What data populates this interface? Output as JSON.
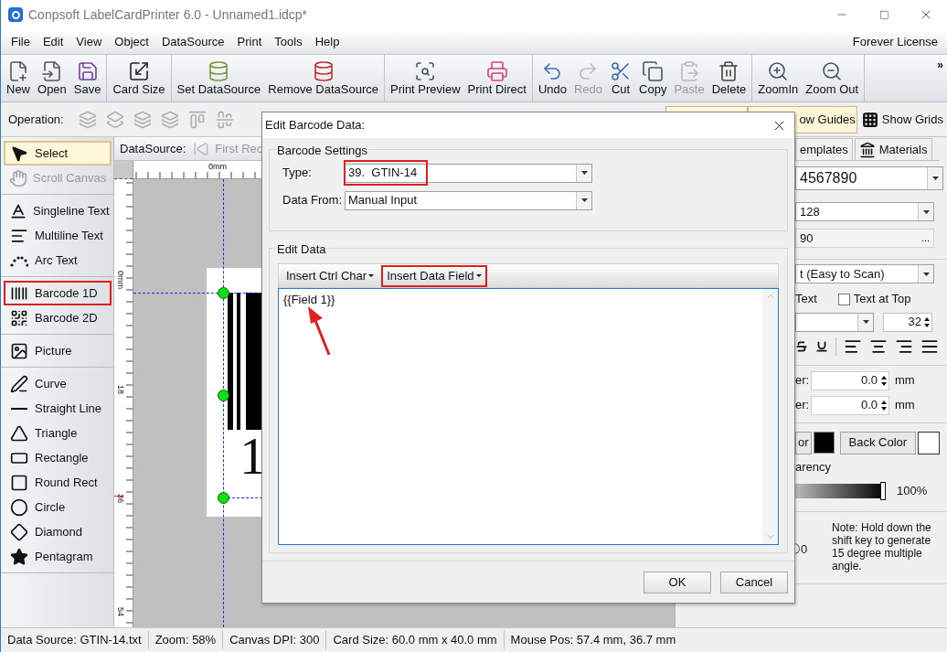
{
  "window": {
    "title": "Conpsoft LabelCardPrinter 6.0 - Unnamed1.idcp*"
  },
  "menu": {
    "items": [
      "File",
      "Edit",
      "View",
      "Object",
      "DataSource",
      "Print",
      "Tools",
      "Help"
    ],
    "license": "Forever License"
  },
  "toolbar": {
    "groups": [
      [
        {
          "label": "New",
          "disabled": false
        },
        {
          "label": "Open",
          "disabled": false
        },
        {
          "label": "Save",
          "disabled": false
        }
      ],
      [
        {
          "label": "Card Size",
          "disabled": false
        }
      ],
      [
        {
          "label": "Set DataSource",
          "disabled": false
        },
        {
          "label": "Remove DataSource",
          "disabled": false
        }
      ],
      [
        {
          "label": "Print Preview",
          "disabled": false
        },
        {
          "label": "Print Direct",
          "disabled": false
        }
      ],
      [
        {
          "label": "Undo",
          "disabled": false
        },
        {
          "label": "Redo",
          "disabled": true
        },
        {
          "label": "Cut",
          "disabled": false
        },
        {
          "label": "Copy",
          "disabled": false
        },
        {
          "label": "Paste",
          "disabled": true
        },
        {
          "label": "Delete",
          "disabled": false
        }
      ],
      [
        {
          "label": "ZoomIn",
          "disabled": false
        },
        {
          "label": "Zoom Out",
          "disabled": false
        }
      ]
    ],
    "overflow": "»"
  },
  "operation_bar": {
    "label": "Operation:",
    "view_buttons": [
      {
        "selected": true
      },
      {
        "label": "ow Guides",
        "selected": true
      },
      {
        "label": "Show Grids",
        "selected": false
      }
    ]
  },
  "tools": {
    "groups": [
      [
        {
          "label": "Select",
          "selected": true,
          "disabled": false,
          "highlighted": false
        },
        {
          "label": "Scroll Canvas",
          "selected": false,
          "disabled": true,
          "highlighted": false
        }
      ],
      [
        {
          "label": "Singleline Text",
          "selected": false,
          "disabled": false,
          "highlighted": false
        },
        {
          "label": "Multiline Text",
          "selected": false,
          "disabled": false,
          "highlighted": false
        },
        {
          "label": "Arc Text",
          "selected": false,
          "disabled": false,
          "highlighted": false
        }
      ],
      [
        {
          "label": "Barcode 1D",
          "selected": false,
          "disabled": false,
          "highlighted": true
        },
        {
          "label": "Barcode 2D",
          "selected": false,
          "disabled": false,
          "highlighted": false
        }
      ],
      [
        {
          "label": "Picture",
          "selected": false,
          "disabled": false,
          "highlighted": false
        }
      ],
      [
        {
          "label": "Curve",
          "selected": false,
          "disabled": false,
          "highlighted": false
        },
        {
          "label": "Straight Line",
          "selected": false,
          "disabled": false,
          "highlighted": false
        },
        {
          "label": "Triangle",
          "selected": false,
          "disabled": false,
          "highlighted": false
        },
        {
          "label": "Rectangle",
          "selected": false,
          "disabled": false,
          "highlighted": false
        },
        {
          "label": "Round Rect",
          "selected": false,
          "disabled": false,
          "highlighted": false
        },
        {
          "label": "Circle",
          "selected": false,
          "disabled": false,
          "highlighted": false
        },
        {
          "label": "Diamond",
          "selected": false,
          "disabled": false,
          "highlighted": false
        },
        {
          "label": "Pentagram",
          "selected": false,
          "disabled": false,
          "highlighted": false
        }
      ]
    ]
  },
  "datasource_bar": {
    "label": "DataSource:",
    "first_record": "First Rec"
  },
  "canvas": {
    "top_ruler_label": "0mm",
    "left_ruler_labels": [
      "0mm",
      "18",
      "36",
      "54"
    ],
    "barcode_digit": "1"
  },
  "properties_panel": {
    "tabs": [
      {
        "label": "emplates",
        "selected": false
      },
      {
        "label": "Materials",
        "selected": false
      }
    ],
    "barcode_value": "4567890",
    "barcode_type": "128",
    "data_value": "90",
    "data_button": "...",
    "text_style": "t (Easy to Scan)",
    "show_text_label": "Text",
    "text_at_top": {
      "label": "Text at Top",
      "checked": false
    },
    "font_size": "32",
    "offsets": [
      {
        "label": "er:",
        "value": "0.0",
        "unit": "mm"
      },
      {
        "label": "er:",
        "value": "0.0",
        "unit": "mm"
      }
    ],
    "fore_color_button": "or",
    "back_color_button": "Back Color",
    "swatches": [
      {
        "color": "#000000"
      },
      {
        "color": "#ffffff"
      }
    ],
    "transparency_label": "arency",
    "transparency": {
      "level": 1
    },
    "transparency_reading": "100%",
    "rotation_reading": "0",
    "note": "Note: Hold down the shift key to generate 15 degree multiple angle."
  },
  "dialog": {
    "title": "Edit Barcode Data:",
    "settings_group": "Barcode Settings",
    "fields": [
      {
        "label": "Type:",
        "value": "39.  GTIN-14",
        "highlighted": true
      },
      {
        "label": "Data From:",
        "value": "Manual Input",
        "highlighted": false
      }
    ],
    "edit_group": "Edit Data",
    "insert_buttons": [
      {
        "label": "Insert Ctrl Char",
        "highlighted": false
      },
      {
        "label": "Insert Data Field",
        "highlighted": true
      }
    ],
    "text": "{{Field 1}}",
    "buttons": [
      "OK",
      "Cancel"
    ]
  },
  "status_bar": [
    "Data Source: GTIN-14.txt",
    "Zoom: 58%",
    "Canvas DPI: 300",
    "Card Size: 60.0 mm x 40.0 mm",
    "Mouse Pos: 57.4 mm, 36.7 mm"
  ]
}
